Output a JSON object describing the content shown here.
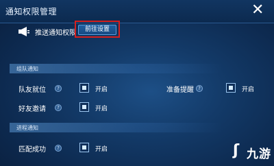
{
  "window": {
    "title": "通知权限管理",
    "close_label": "✕"
  },
  "push": {
    "label": "推送通知权限",
    "goto_button": "前往设置"
  },
  "sections": [
    {
      "header": "组队通知"
    },
    {
      "header": "进程通知"
    }
  ],
  "items": {
    "teammate_ready": {
      "label": "队友就位",
      "state": "开启"
    },
    "ready_reminder": {
      "label": "准备提醒",
      "state": "开启"
    },
    "friend_invite": {
      "label": "好友邀请",
      "state": "开启"
    },
    "match_success": {
      "label": "匹配成功",
      "state": "开启"
    }
  },
  "watermark": {
    "icon": "ʃ",
    "text": "九游"
  },
  "colors": {
    "highlight_outline": "#d8201e",
    "panel_bg": "#133a68",
    "accent": "#5aa0e0"
  }
}
